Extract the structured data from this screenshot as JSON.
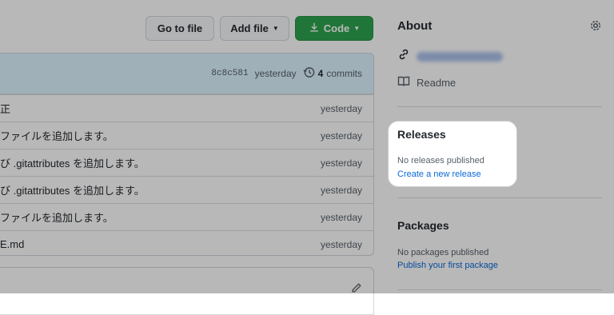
{
  "toolbar": {
    "go_to_file": "Go to file",
    "add_file": "Add file",
    "code": "Code"
  },
  "latest_commit": {
    "sha": "8c8c581",
    "time": "yesterday",
    "commits_count": "4",
    "commits_label": "commits"
  },
  "files": [
    {
      "message": "正",
      "time": "yesterday"
    },
    {
      "message": "ファイルを追加します。",
      "time": "yesterday"
    },
    {
      "message": "び .gitattributes を追加します。",
      "time": "yesterday"
    },
    {
      "message": "び .gitattributes を追加します。",
      "time": "yesterday"
    },
    {
      "message": "ファイルを追加します。",
      "time": "yesterday"
    },
    {
      "message": "E.md",
      "time": "yesterday"
    }
  ],
  "about": {
    "title": "About",
    "readme": "Readme"
  },
  "releases": {
    "title": "Releases",
    "empty": "No releases published",
    "create_link": "Create a new release"
  },
  "packages": {
    "title": "Packages",
    "empty": "No packages published",
    "publish_link": "Publish your first package"
  },
  "colors": {
    "primary_button": "#2da44e",
    "link": "#0969da",
    "highlight_background": "#ddf4ff"
  },
  "icons": [
    "download-icon",
    "history-icon",
    "link-icon",
    "book-icon",
    "gear-icon",
    "pencil-icon"
  ]
}
